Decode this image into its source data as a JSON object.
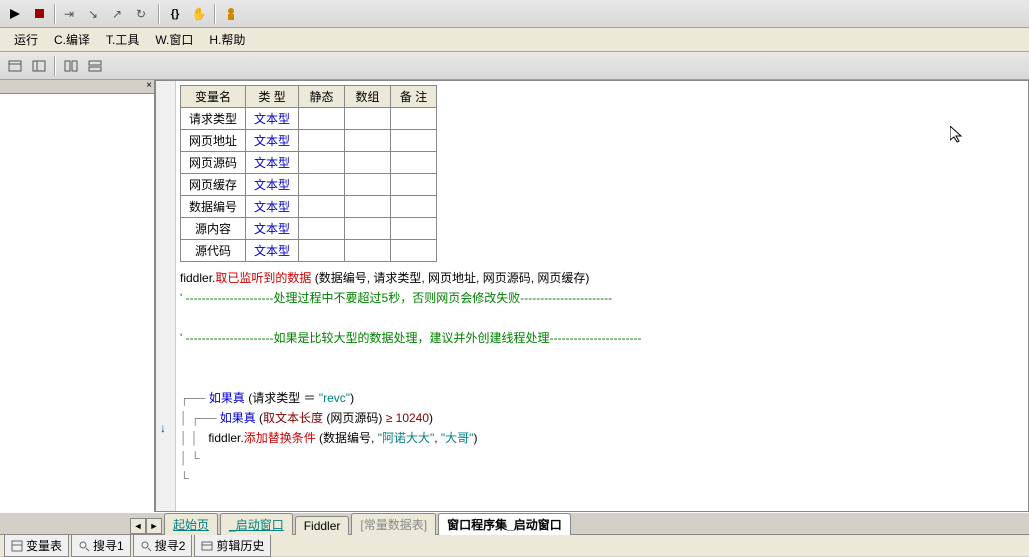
{
  "menu": {
    "run": "运行",
    "compile": "C.编译",
    "tools": "T.工具",
    "window": "W.窗口",
    "help": "H.帮助"
  },
  "table": {
    "headers": [
      "变量名",
      "类 型",
      "静态",
      "数组",
      "备 注"
    ],
    "rows": [
      {
        "name": "请求类型",
        "type": "文本型"
      },
      {
        "name": "网页地址",
        "type": "文本型"
      },
      {
        "name": "网页源码",
        "type": "文本型"
      },
      {
        "name": "网页缓存",
        "type": "文本型"
      },
      {
        "name": "数据编号",
        "type": "文本型"
      },
      {
        "name": "源内容",
        "type": "文本型"
      },
      {
        "name": "源代码",
        "type": "文本型"
      }
    ]
  },
  "code": {
    "l1a": "fiddler.",
    "l1b": "取已监听到的数据",
    "l1c": " (数据编号, 请求类型, 网页地址, 网页源码, 网页缓存)",
    "c1": "' ----------------------处理过程中不要超过5秒，否则网页会修改失败-----------------------",
    "c2": "' ----------------------如果是比较大型的数据处理，建议并外创建线程处理-----------------------",
    "if1": "如果真",
    "if1p": " (请求类型 ＝ ",
    "if1s": "\"revc\"",
    "if1e": ")",
    "if2": "如果真",
    "if2p": " (",
    "if2fn": "取文本长度",
    "if2a": " (网页源码) ",
    "if2op": "≥",
    "if2n": " 10240",
    "if2e": ")",
    "l3a": "fiddler.",
    "l3b": "添加替换条件",
    "l3c": " (数据编号, ",
    "l3s1": "\"阿诺大大\"",
    "l3d": ", ",
    "l3s2": "\"大哥\"",
    "l3e": ")"
  },
  "tabs": {
    "t1": "起始页",
    "t2": "_启动窗口",
    "t3": "Fiddler",
    "t4": "[常量数据表]",
    "t5": "窗口程序集_启动窗口"
  },
  "bottom": {
    "b1": "变量表",
    "b2": "搜寻1",
    "b3": "搜寻2",
    "b4": "剪辑历史"
  }
}
